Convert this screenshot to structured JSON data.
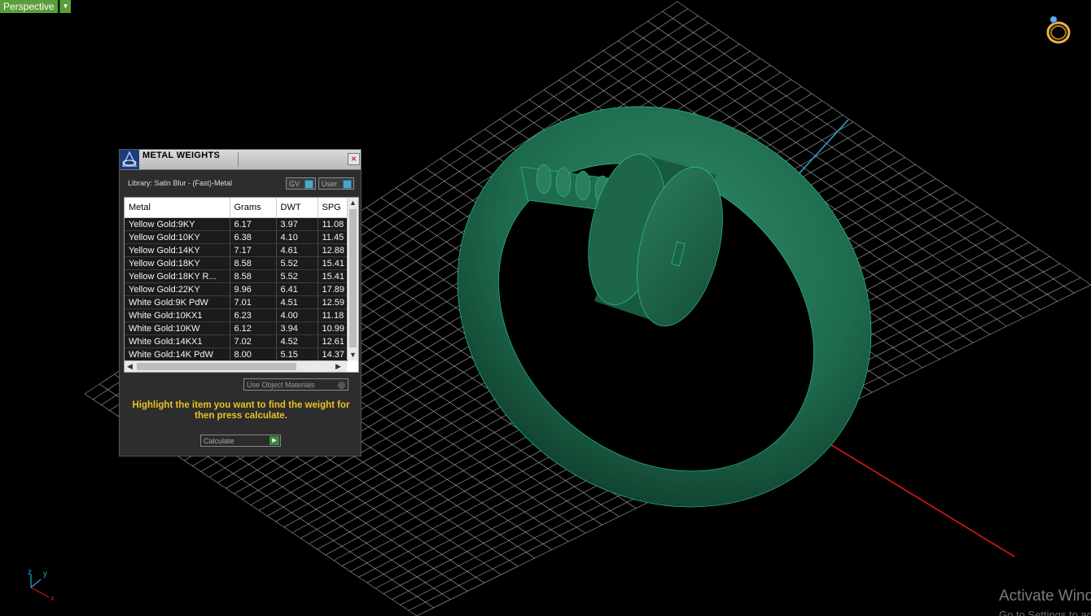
{
  "viewport": {
    "view_name": "Perspective",
    "dropdown_glyph": "▼",
    "axis_labels": {
      "x": "x",
      "y": "y",
      "z": "z"
    },
    "watermark": {
      "line1": "Activate Windows",
      "line2": "Go to Settings to activate Windows."
    }
  },
  "panel": {
    "title": "METAL WEIGHTS",
    "close_glyph": "×",
    "library_label": "Library: Satin Blur - (Fast)-Metal",
    "gv_button": "GV",
    "user_button": "User",
    "columns": [
      "Metal",
      "Grams",
      "DWT",
      "SPG"
    ],
    "rows": [
      [
        "Yellow Gold:9KY",
        "6.17",
        "3.97",
        "11.08"
      ],
      [
        "Yellow Gold:10KY",
        "6.38",
        "4.10",
        "11.45"
      ],
      [
        "Yellow Gold:14KY",
        "7.17",
        "4.61",
        "12.88"
      ],
      [
        "Yellow Gold:18KY",
        "8.58",
        "5.52",
        "15.41"
      ],
      [
        "Yellow Gold:18KY R...",
        "8.58",
        "5.52",
        "15.41"
      ],
      [
        "Yellow Gold:22KY",
        "9.96",
        "6.41",
        "17.89"
      ],
      [
        "White Gold:9K PdW",
        "7.01",
        "4.51",
        "12.59"
      ],
      [
        "White Gold:10KX1",
        "6.23",
        "4.00",
        "11.18"
      ],
      [
        "White Gold:10KW",
        "6.12",
        "3.94",
        "10.99"
      ],
      [
        "White Gold:14KX1",
        "7.02",
        "4.52",
        "12.61"
      ],
      [
        "White Gold:14K PdW",
        "8.00",
        "5.15",
        "14.37"
      ]
    ],
    "use_object_materials": "Use Object Materials",
    "instruction": "Highlight the item you want to find the weight for then press calculate.",
    "calculate_button": "Calculate"
  },
  "colors": {
    "background": "#000000",
    "grid": "#bdbdbd",
    "model": "#1e6b4e",
    "model_edge": "#2fd49a",
    "axis_x": "#c01818",
    "axis_y": "#2aa6c8",
    "view_label_bg": "#5a9e3a",
    "instruction_text": "#e9c223"
  },
  "icons": {
    "ring_icon": "ring-icon",
    "app_logo": "app-logo-icon",
    "axis_gizmo": "axis-gizmo-icon"
  }
}
